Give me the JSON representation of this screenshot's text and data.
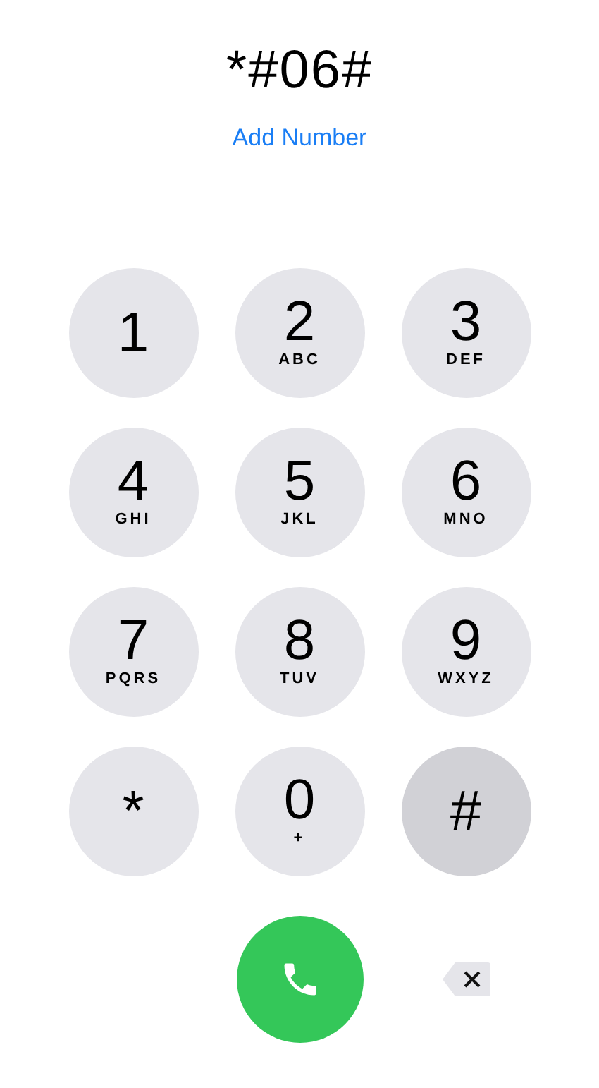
{
  "display": {
    "number": "*#06#",
    "add_number": "Add Number"
  },
  "keys": [
    {
      "digit": "1",
      "pressed": false
    },
    {
      "digit": "2",
      "letters": "ABC",
      "pressed": false
    },
    {
      "digit": "3",
      "letters": "DEF",
      "pressed": false
    },
    {
      "digit": "4",
      "letters": "GHI",
      "pressed": false
    },
    {
      "digit": "5",
      "letters": "JKL",
      "pressed": false
    },
    {
      "digit": "6",
      "letters": "MNO",
      "pressed": false
    },
    {
      "digit": "7",
      "letters": "PQRS",
      "pressed": false
    },
    {
      "digit": "8",
      "letters": "TUV",
      "pressed": false
    },
    {
      "digit": "9",
      "letters": "WXYZ",
      "pressed": false
    },
    {
      "digit": "*",
      "pressed": false
    },
    {
      "digit": "0",
      "letters": "+",
      "pressed": false
    },
    {
      "digit": "#",
      "pressed": true
    }
  ]
}
